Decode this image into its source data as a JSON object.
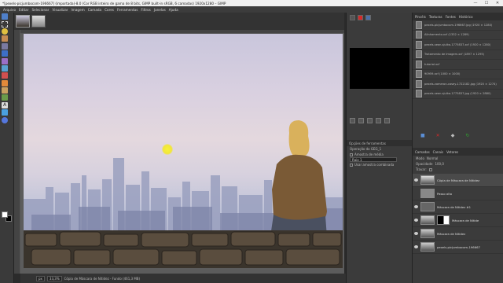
{
  "window": {
    "title": "*[pexels-picjumbocom-196667] (importada)-8.0 (Cor RGB inteiro de gama de 8 bits, GIMP built-in sRGB, 6 camadas) 1920x1280 – GIMP",
    "minimize": "—",
    "maximize": "☐",
    "close": "✕"
  },
  "menu": [
    "Arquivo",
    "Editar",
    "Selecionar",
    "Visualizar",
    "Imagem",
    "Camada",
    "Cores",
    "Ferramentas",
    "Filtros",
    "Janelas",
    "Ajuda"
  ],
  "status": {
    "unit": "px",
    "zoom": "33,3%",
    "message": "Cópia de Máscara de Nitidez - Fundo (461,3 MB)"
  },
  "colors": {
    "accent_red": "#d62a2a",
    "accent_green": "#2fa32f",
    "fg": "#ffffff",
    "bg": "#000000"
  },
  "tool_options": {
    "tab": "Opções de ferramentas",
    "title": "Operação do GEG_1",
    "raw_output": "Amostra de média",
    "mode_label": "Raio",
    "mode_value": "1",
    "option": "Usar amostra combinada"
  },
  "dock_tabs": [
    "Pincéis",
    "Texturas",
    "Fontes",
    "Histórico"
  ],
  "documents": [
    "pexels-picjumbocom-196667.jpg (1920 × 1280)",
    "Alinhamento.xcf (1332 × 1289)",
    "pexels-sean-sjulka-1775837.xcf (1920 × 1280)",
    "Tratamento de Imagem.xcf (1897 × 1295)",
    "tutorial.xcf",
    "90959.xcf (1000 × 1000)",
    "pexels-vameron-casey-1722182.jpg (1920 × 1274)",
    "pexels-sean-sjulka-1775837.jpg (1920 × 2880)"
  ],
  "layers_panel": {
    "tabs": [
      "Camadas",
      "Canais",
      "Vetores"
    ],
    "mode_label": "Modo",
    "mode_value": "Normal",
    "opacity_label": "Opacidade",
    "opacity_value": "100,0",
    "lock_label": "Travar:",
    "layers": [
      {
        "name": "Cópia de Máscara de Nitidez"
      },
      {
        "name": "Passo alto"
      },
      {
        "name": "Máscara de Nitidez #1"
      },
      {
        "name": "Máscara de Nitide"
      },
      {
        "name": "Máscara de Nitidez"
      },
      {
        "name": "pexels-picjumbocom-196667"
      }
    ]
  }
}
